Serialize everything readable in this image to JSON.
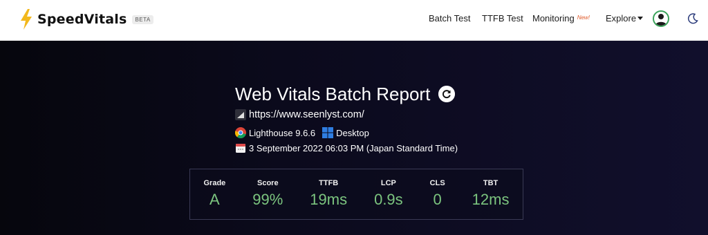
{
  "brand": {
    "name": "SpeedVitals",
    "badge": "BETA",
    "accent": "#f2b81c"
  },
  "nav": {
    "batch_test": "Batch Test",
    "ttfb_test": "TTFB Test",
    "monitoring": "Monitoring",
    "monitoring_badge": "New!",
    "explore": "Explore"
  },
  "report": {
    "title": "Web Vitals Batch Report",
    "url": "https://www.seenlyst.com/",
    "lighthouse": "Lighthouse 9.6.6",
    "device": "Desktop",
    "date": "3 September 2022 06:03 PM (Japan Standard Time)"
  },
  "metrics": [
    {
      "label": "Grade",
      "value": "A"
    },
    {
      "label": "Score",
      "value": "99%"
    },
    {
      "label": "TTFB",
      "value": "19ms"
    },
    {
      "label": "LCP",
      "value": "0.9s"
    },
    {
      "label": "CLS",
      "value": "0"
    },
    {
      "label": "TBT",
      "value": "12ms"
    }
  ],
  "colors": {
    "good": "#7cc57f",
    "background": "#0b0a1a"
  }
}
